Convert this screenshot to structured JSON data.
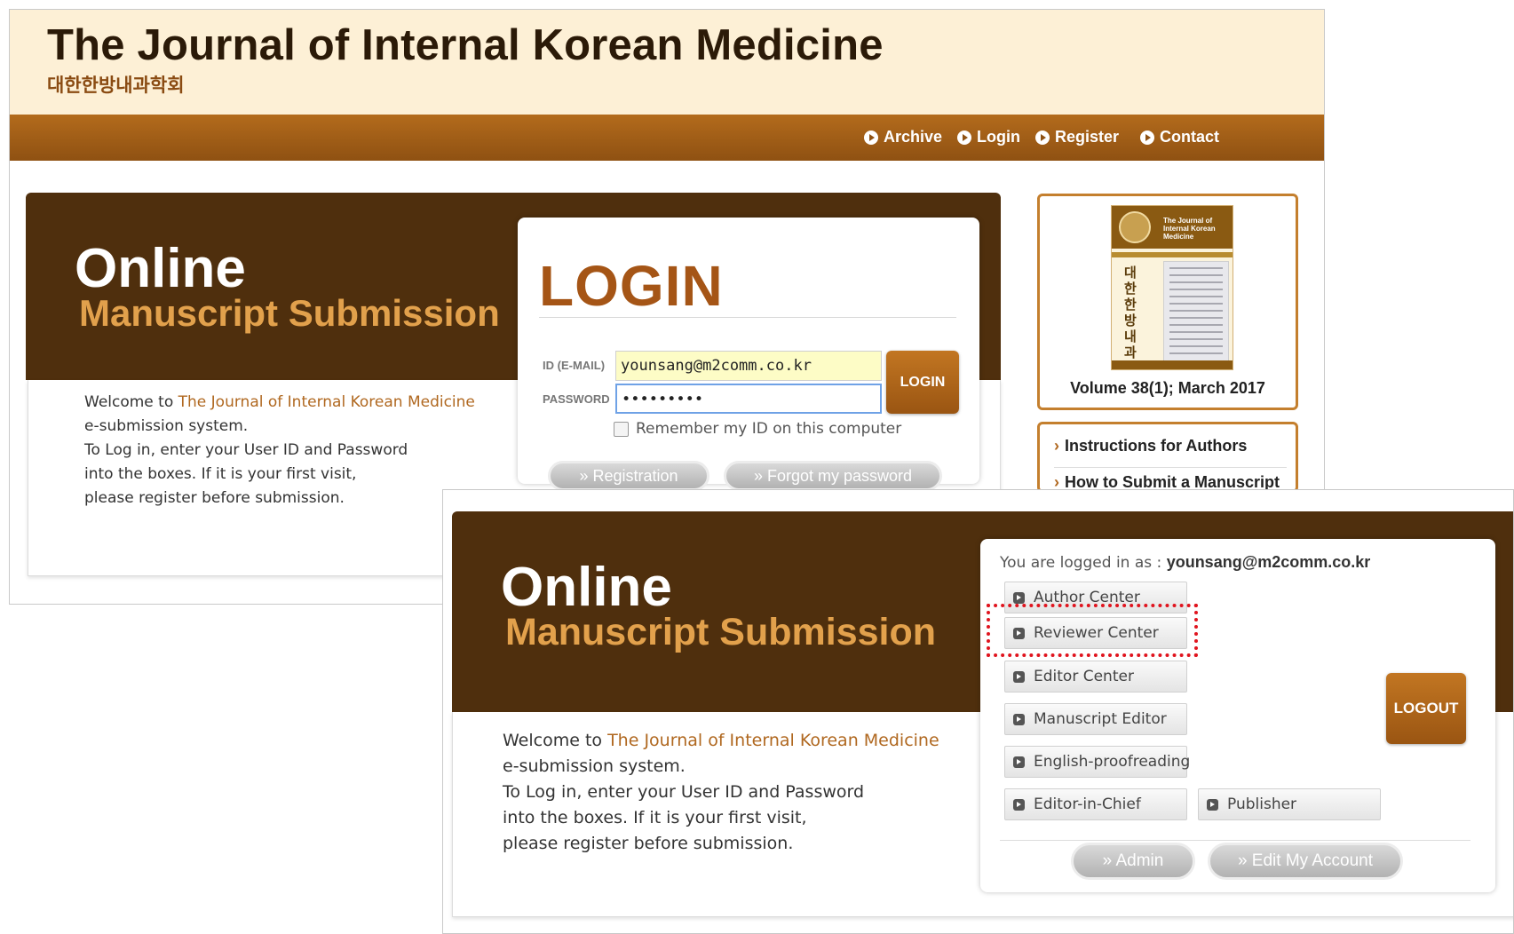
{
  "site": {
    "title": "The Journal of Internal Korean Medicine",
    "subtitle": "대한한방내과학회"
  },
  "nav": [
    {
      "label": "Archive"
    },
    {
      "label": "Login"
    },
    {
      "label": "Register"
    },
    {
      "label": "Contact"
    }
  ],
  "banner": {
    "online": "Online",
    "manuscript": "Manuscript Submission"
  },
  "welcome": {
    "prefix": "Welcome to ",
    "journal": "The Journal of Internal Korean Medicine",
    "line2": "e-submission system.",
    "line3": "To Log in, enter your User ID and Password",
    "line4": "into the boxes.  If it is your first visit,",
    "line5": "please register before submission."
  },
  "login": {
    "title": "LOGIN",
    "id_label": "ID (E-MAIL)",
    "id_value": "younsang@m2comm.co.kr",
    "password_label": "PASSWORD",
    "password_value": "•••••••••",
    "button": "LOGIN",
    "remember": "Remember my ID on this computer",
    "registration": "»  Registration",
    "forgot": "»  Forgot my password"
  },
  "sidebar": {
    "volume": "Volume 38(1); March 2017",
    "cover_title": "The Journal of Internal Korean Medicine",
    "links": [
      {
        "label": "Instructions for Authors"
      },
      {
        "label": "How to Submit a Manuscript"
      }
    ]
  },
  "logged_in": {
    "prefix": "You are logged in as : ",
    "user": "younsang@m2comm.co.kr",
    "menu": [
      {
        "label": "Author Center"
      },
      {
        "label": "Reviewer Center"
      },
      {
        "label": "Editor Center"
      },
      {
        "label": "Manuscript Editor"
      },
      {
        "label": "English-proofreading"
      },
      {
        "label": "Editor-in-Chief"
      },
      {
        "label": "Publisher"
      }
    ],
    "logout": "LOGOUT",
    "admin": "»  Admin",
    "edit_account": "»  Edit My Account"
  },
  "colors": {
    "brand_brown": "#4f2f0d",
    "accent_orange": "#e2a14c",
    "highlight_red": "#e0141e"
  }
}
